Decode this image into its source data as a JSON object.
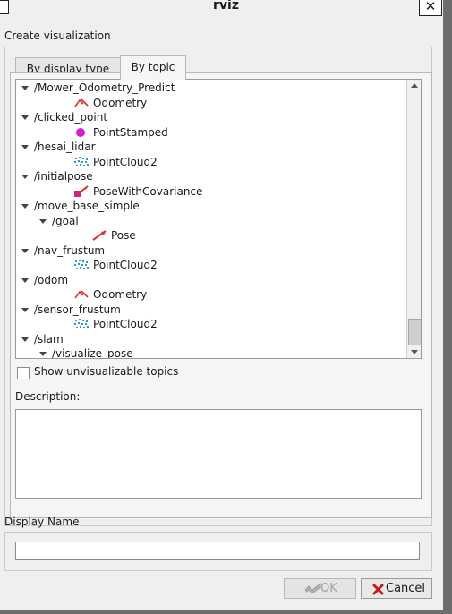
{
  "window": {
    "title": "rviz",
    "close_glyph": "✕"
  },
  "group": {
    "title": "Create visualization"
  },
  "tabs": [
    {
      "label": "By display type",
      "active": false
    },
    {
      "label": "By topic",
      "active": true
    }
  ],
  "tree": [
    {
      "label": "/Mower_Odometry_Predict",
      "type": "topic",
      "depth": 0,
      "expanded": true
    },
    {
      "label": "Odometry",
      "type": "display",
      "depth": 1,
      "icon": "odometry-icon"
    },
    {
      "label": "/clicked_point",
      "type": "topic",
      "depth": 0,
      "expanded": true
    },
    {
      "label": "PointStamped",
      "type": "display",
      "depth": 1,
      "icon": "point-stamped-icon"
    },
    {
      "label": "/hesai_lidar",
      "type": "topic",
      "depth": 0,
      "expanded": true
    },
    {
      "label": "PointCloud2",
      "type": "display",
      "depth": 1,
      "icon": "pointcloud2-icon"
    },
    {
      "label": "/initialpose",
      "type": "topic",
      "depth": 0,
      "expanded": true
    },
    {
      "label": "PoseWithCovariance",
      "type": "display",
      "depth": 1,
      "icon": "pose-with-covariance-icon"
    },
    {
      "label": "/move_base_simple",
      "type": "topic",
      "depth": 0,
      "expanded": true
    },
    {
      "label": "/goal",
      "type": "topic",
      "depth": 1,
      "expanded": true
    },
    {
      "label": "Pose",
      "type": "display",
      "depth": 2,
      "icon": "pose-icon"
    },
    {
      "label": "/nav_frustum",
      "type": "topic",
      "depth": 0,
      "expanded": true
    },
    {
      "label": "PointCloud2",
      "type": "display",
      "depth": 1,
      "icon": "pointcloud2-icon"
    },
    {
      "label": "/odom",
      "type": "topic",
      "depth": 0,
      "expanded": true
    },
    {
      "label": "Odometry",
      "type": "display",
      "depth": 1,
      "icon": "odometry-icon"
    },
    {
      "label": "/sensor_frustum",
      "type": "topic",
      "depth": 0,
      "expanded": true
    },
    {
      "label": "PointCloud2",
      "type": "display",
      "depth": 1,
      "icon": "pointcloud2-icon"
    },
    {
      "label": "/slam",
      "type": "topic",
      "depth": 0,
      "expanded": true
    },
    {
      "label": "/visualize_pose",
      "type": "topic",
      "depth": 1,
      "expanded": true
    }
  ],
  "show_unvisualizable": {
    "label": "Show unvisualizable topics",
    "checked": false
  },
  "description": {
    "label": "Description:",
    "text": ""
  },
  "display_name": {
    "label": "Display Name",
    "value": ""
  },
  "buttons": {
    "ok": {
      "label": "OK",
      "enabled": false,
      "icon": "ok-icon"
    },
    "cancel": {
      "label": "Cancel",
      "enabled": true,
      "icon": "cancel-icon"
    }
  },
  "colors": {
    "odometry": "#e03030",
    "point_stamped": "#d020d0",
    "pointcloud": "#1a8fd0",
    "pose": "#e03030",
    "covariance": "#d0208a",
    "cancel_x": "#c81818"
  }
}
